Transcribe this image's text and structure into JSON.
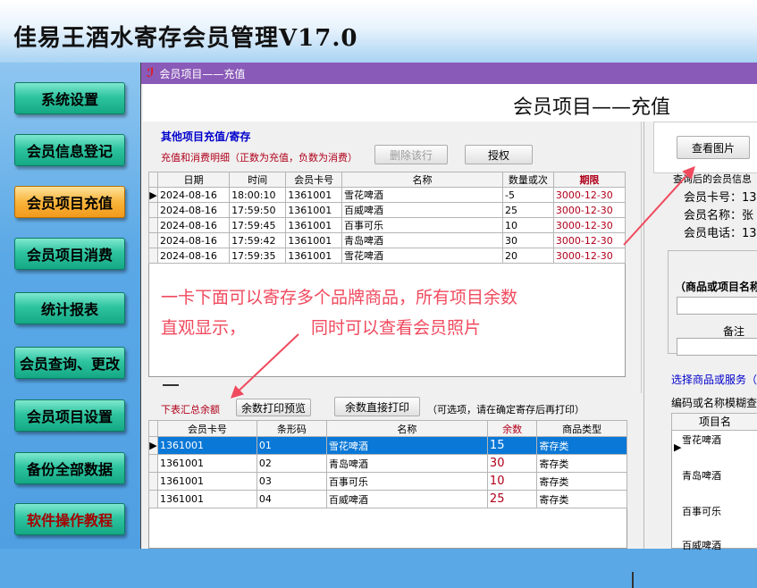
{
  "app": {
    "title": "佳易王酒水寄存会员管理V17.0"
  },
  "sidebar": {
    "items": [
      {
        "label": "系统设置"
      },
      {
        "label": "会员信息登记"
      },
      {
        "label": "会员项目充值"
      },
      {
        "label": "会员项目消费"
      },
      {
        "label": "统计报表"
      },
      {
        "label": "会员查询、更改"
      },
      {
        "label": "会员项目设置"
      },
      {
        "label": "备份全部数据"
      },
      {
        "label": "软件操作教程"
      }
    ]
  },
  "window": {
    "title": "会员项目——充值",
    "header": "会员项目——充值"
  },
  "section1": {
    "title": "其他项目充值/寄存",
    "subtitle": "充值和消费明细（正数为充值，负数为消费）",
    "delete_button": "删除该行",
    "auth_button": "授权",
    "columns": [
      "日期",
      "时间",
      "会员卡号",
      "名称",
      "数量或次",
      "期限"
    ],
    "rows": [
      [
        "2024-08-16",
        "18:00:10",
        "1361001",
        "雪花啤酒",
        "-5",
        "3000-12-30"
      ],
      [
        "2024-08-16",
        "17:59:50",
        "1361001",
        "百威啤酒",
        "25",
        "3000-12-30"
      ],
      [
        "2024-08-16",
        "17:59:45",
        "1361001",
        "百事可乐",
        "10",
        "3000-12-30"
      ],
      [
        "2024-08-16",
        "17:59:42",
        "1361001",
        "青岛啤酒",
        "30",
        "3000-12-30"
      ],
      [
        "2024-08-16",
        "17:59:35",
        "1361001",
        "雪花啤酒",
        "20",
        "3000-12-30"
      ]
    ]
  },
  "annotation": {
    "line1": "一卡下面可以寄存多个品牌商品，所有项目余数",
    "line2a": "直观显示，",
    "line2b": "同时可以查看会员照片"
  },
  "section2": {
    "label": "下表汇总余额",
    "print_preview_button": "余数打印预览",
    "print_direct_button": "余数直接打印",
    "hint": "（可选项，请在确定寄存后再打印）",
    "columns": [
      "会员卡号",
      "条形码",
      "名称",
      "余数",
      "商品类型"
    ],
    "rows": [
      [
        "1361001",
        "01",
        "雪花啤酒",
        "15",
        "寄存类"
      ],
      [
        "1361001",
        "02",
        "青岛啤酒",
        "30",
        "寄存类"
      ],
      [
        "1361001",
        "03",
        "百事可乐",
        "10",
        "寄存类"
      ],
      [
        "1361001",
        "04",
        "百威啤酒",
        "25",
        "寄存类"
      ]
    ]
  },
  "right_panel": {
    "view_photo_button": "查看图片",
    "member_info_label": "查询后的会员信息",
    "card_no_label": "会员卡号：13",
    "name_label": "会员名称：张",
    "phone_label": "会员电话：13",
    "item_name_label": "（商品或项目名称",
    "remark_label": "备注",
    "select_label": "选择商品或服务（",
    "fuzzy_label": "编码或名称模糊查询",
    "list_header": "项目名",
    "list_items": [
      "雪花啤酒",
      "青岛啤酒",
      "百事可乐",
      "百威啤酒"
    ]
  }
}
